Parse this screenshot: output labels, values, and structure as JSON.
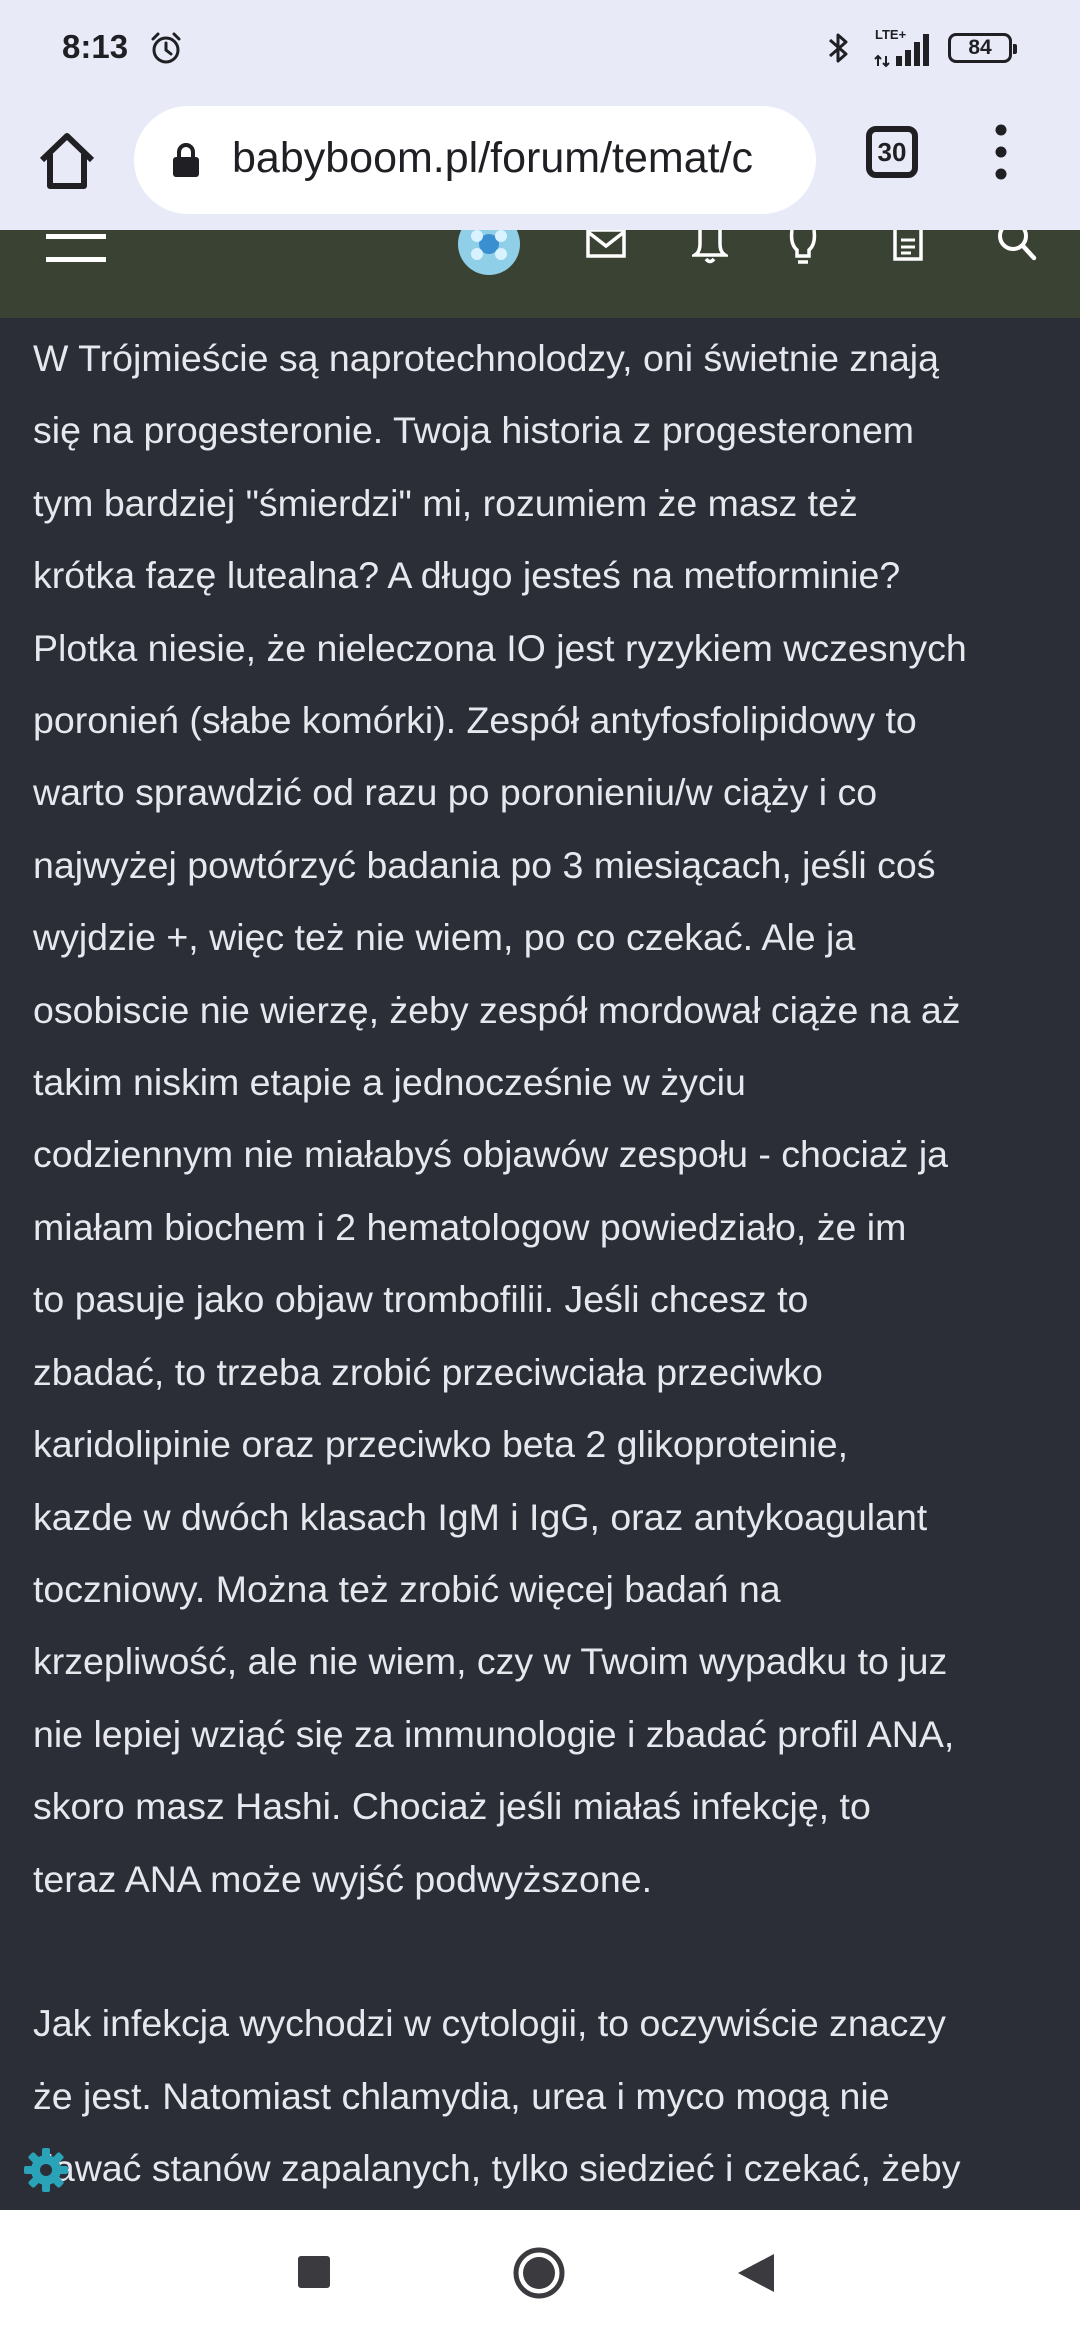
{
  "status_bar": {
    "time": "8:13",
    "network": "LTE+",
    "battery": "84"
  },
  "browser": {
    "url": "babyboom.pl/forum/temat/c",
    "tab_count": "30"
  },
  "post": {
    "lines": [
      "W Trójmieście są naprotechnolodzy, oni świetnie znają",
      "się na progesteronie. Twoja historia z progesteronem",
      "tym bardziej \"śmierdzi\" mi, rozumiem że masz też",
      "krótka fazę lutealna? A długo jesteś na metforminie?",
      "Plotka niesie, że nieleczona IO jest ryzykiem wczesnych",
      "poronień (słabe komórki). Zespół antyfosfolipidowy to",
      "warto sprawdzić od razu po poronieniu/w ciąży i co",
      "najwyżej powtórzyć badania po 3 miesiącach, jeśli coś",
      "wyjdzie +, więc też nie wiem, po co czekać. Ale ja",
      "osobiscie nie wierzę, żeby zespół mordował ciąże na aż",
      "takim niskim etapie a jednocześnie w życiu",
      "codziennym nie miałabyś objawów zespołu - chociaż ja",
      "miałam biochem i 2 hematologow powiedziało, że im",
      "to pasuje jako objaw trombofilii. Jeśli chcesz to",
      "zbadać, to trzeba zrobić przeciwciała przeciwko",
      "karidolipinie oraz przeciwko beta 2 glikoproteinie,",
      "kazde w dwóch klasach IgM i IgG, oraz antykoagulant",
      "toczniowy. Można też zrobić więcej badań na",
      "krzepliwość, ale nie wiem, czy w Twoim wypadku to juz",
      "nie lepiej wziąć się za immunologie i zbadać profil ANA,",
      "skoro masz Hashi. Chociaż jeśli miałaś infekcję, to",
      "teraz ANA może wyjść podwyższone."
    ],
    "lines2": [
      "Jak infekcja wychodzi w cytologii, to oczywiście znaczy",
      "że jest. Natomiast chlamydia, urea i myco mogą nie",
      "dawać stanów zapalanych, tylko siedzieć i czekać, żeby"
    ]
  },
  "colors": {
    "status_bg": "#e8eaf8",
    "site_nav_bg": "#3a4234",
    "content_bg": "#2b2e36",
    "content_text": "#e6e8ee",
    "accent_gear": "#2aa3b8"
  },
  "icons": {
    "alarm": "alarm-icon",
    "bluetooth": "bluetooth-icon",
    "signal": "signal-icon",
    "home": "home-icon",
    "lock": "lock-icon",
    "menu": "more-vert-icon",
    "hamburger": "hamburger-menu-icon",
    "avatar": "avatar",
    "mail": "mail-icon",
    "bell": "bell-icon",
    "bulb": "lightbulb-icon",
    "doc": "document-icon",
    "search": "search-icon",
    "gear": "gear-icon",
    "nav_recents": "recents-icon",
    "nav_home": "home-circle-icon",
    "nav_back": "back-icon"
  }
}
